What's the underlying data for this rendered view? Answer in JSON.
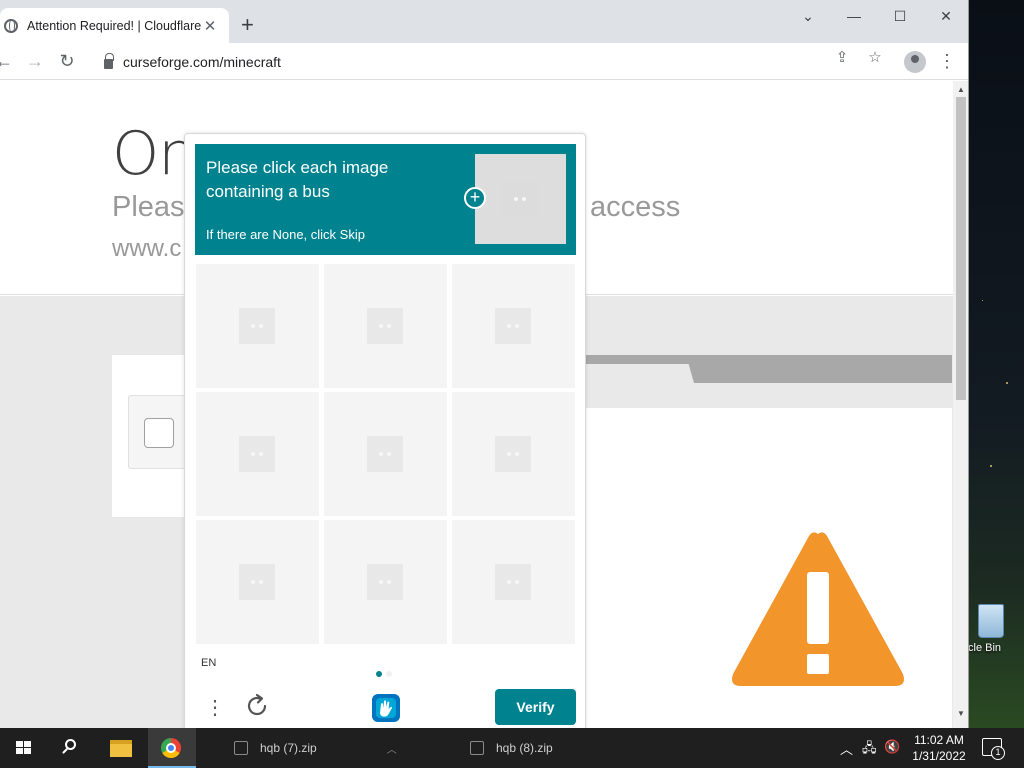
{
  "browser": {
    "tab_title": "Attention Required! | Cloudflare",
    "tab_close": "✕",
    "new_tab": "+",
    "url": "curseforge.com/minecraft",
    "window_controls": {
      "minimize": "—",
      "maximize": "☐",
      "close": "✕",
      "tab_search": "⌄"
    }
  },
  "page": {
    "heading": "On",
    "subtitle_left": "Please",
    "subtitle_right": "access",
    "domain": "www.c"
  },
  "captcha": {
    "prompt": "Please click each image containing a bus",
    "hint": "If there are None, click Skip",
    "language": "EN",
    "verify_label": "Verify",
    "menu_glyph": "⋮",
    "accent_color": "#00838f",
    "grid_cells": 9,
    "pager": {
      "pages": 2,
      "current": 1
    }
  },
  "desktop": {
    "recycle_bin_label": "cle Bin"
  },
  "taskbar": {
    "items": [
      {
        "label": "hqb (7).zip"
      },
      {
        "label": "hqb (8).zip"
      }
    ],
    "clock_time": "11:02 AM",
    "clock_date": "1/31/2022",
    "notification_count": "1"
  },
  "colors": {
    "warning_orange": "#f2952b",
    "hcaptcha_teal": "#00838f"
  }
}
